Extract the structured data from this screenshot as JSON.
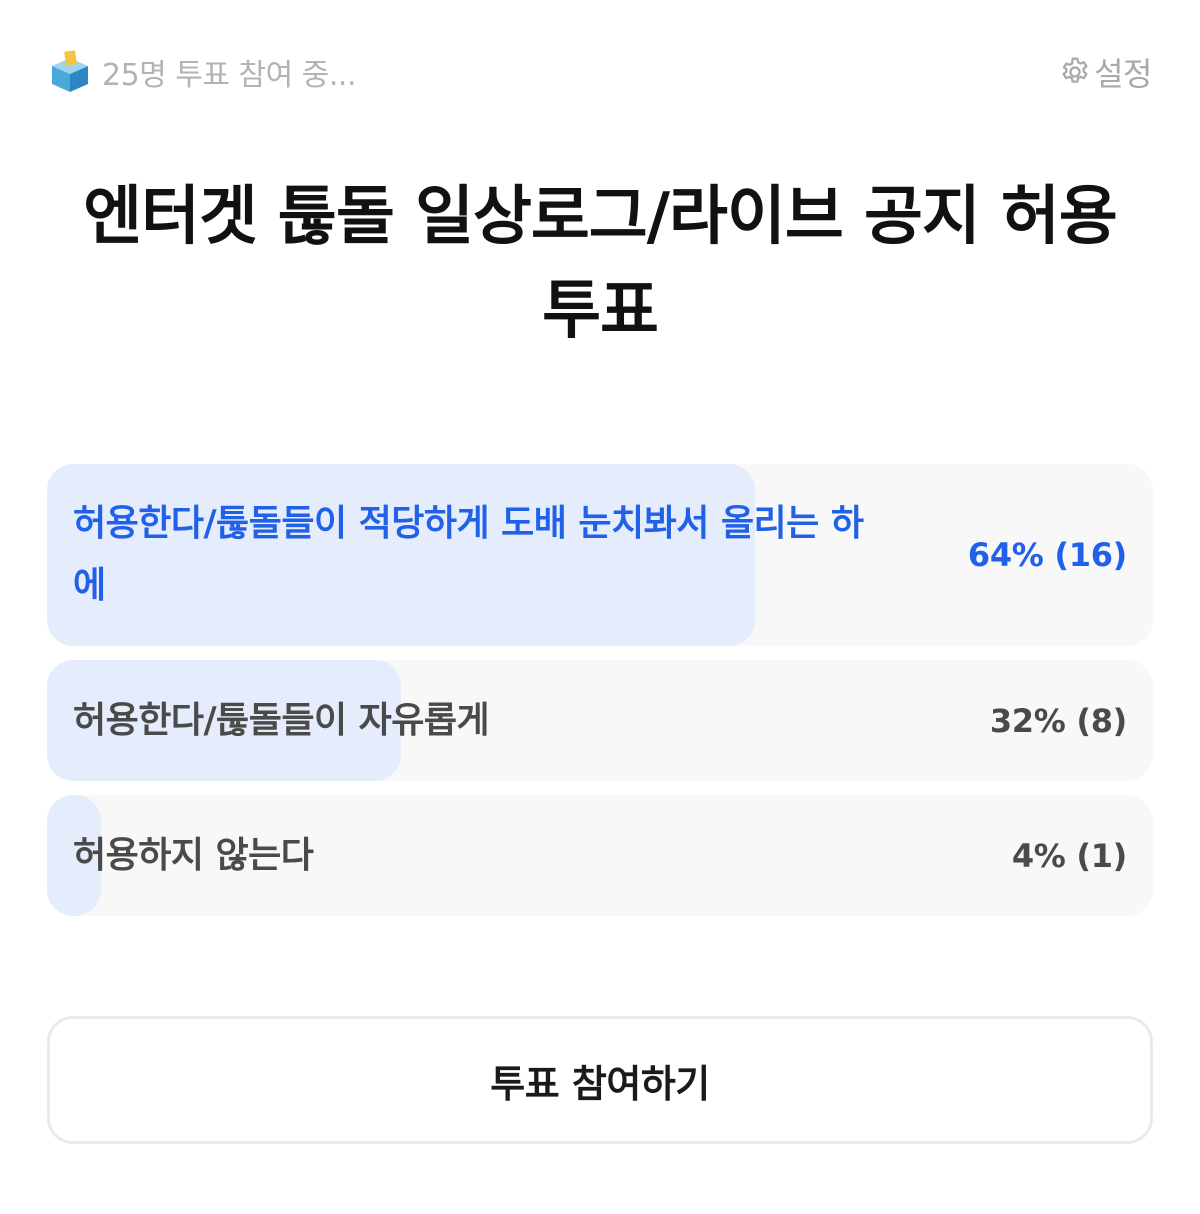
{
  "header": {
    "participants_icon": "ballot-box-icon",
    "participants_text": "25명 투표 참여 중...",
    "settings_icon": "gear-icon",
    "settings_label": "설정"
  },
  "poll": {
    "title": "엔터겟 툲돌 일상로그/라이브 공지 허용 투표",
    "options": [
      {
        "label": "허용한다/툲돌들이 적당하게 도배 눈치봐서 올리는 하에",
        "result": "64% (16)",
        "percent": 64,
        "selected": true
      },
      {
        "label": "허용한다/툲돌들이 자유롭게",
        "result": "32% (8)",
        "percent": 32,
        "selected": false
      },
      {
        "label": "허용하지 않는다",
        "result": "4% (1)",
        "percent": 4,
        "selected": false
      }
    ]
  },
  "vote_button": {
    "label": "투표 참여하기"
  },
  "colors": {
    "accent": "#2160e8",
    "fill": "#e5edfc",
    "option_bg": "#f8f8f8",
    "muted_text": "#b3b3b3"
  }
}
